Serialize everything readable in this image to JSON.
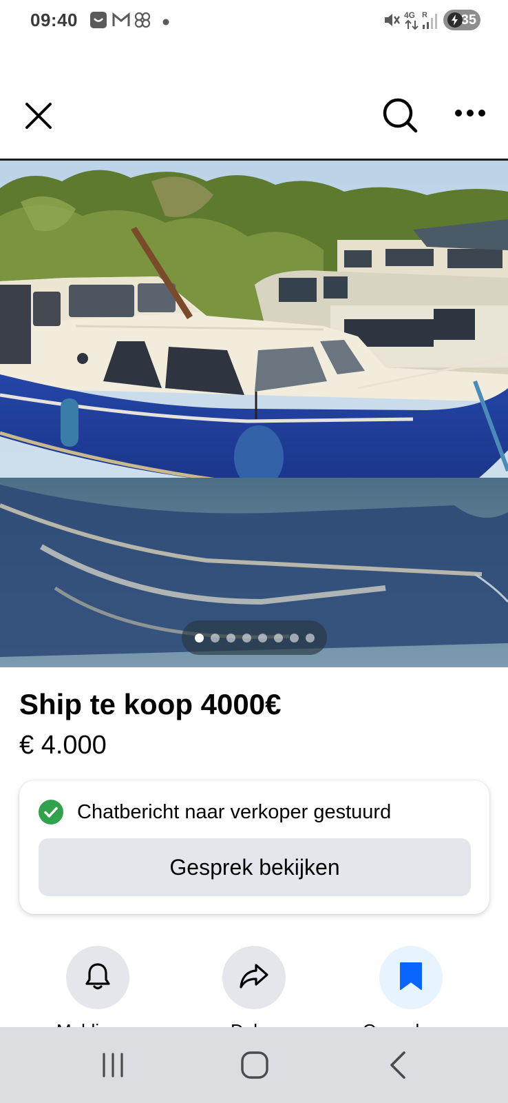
{
  "status_bar": {
    "time": "09:40",
    "battery": "35",
    "icons": [
      "notification-app-icon",
      "gmail-icon",
      "pinwheel-icon",
      "dot-icon",
      "mute-icon",
      "4g-signal-icon",
      "signal-bars-icon",
      "battery-charging-icon"
    ]
  },
  "app_bar": {
    "icons": [
      "close-icon",
      "search-icon",
      "more-options-icon"
    ]
  },
  "photo": {
    "alt": "Blue and white motor boat moored at a pier",
    "pager_count": 8,
    "pager_active": 1
  },
  "listing": {
    "title": "Ship te koop 4000€",
    "price": "€ 4.000"
  },
  "message_card": {
    "status": "Chatbericht naar verkoper gestuurd",
    "button": "Gesprek bekijken"
  },
  "actions": [
    {
      "label": "Meldingen",
      "icon": "bell-icon"
    },
    {
      "label": "Delen",
      "icon": "share-icon"
    },
    {
      "label": "Opgeslagen",
      "icon": "bookmark-icon"
    }
  ],
  "nav_bar": {
    "icons": [
      "recent-apps-icon",
      "home-icon",
      "back-icon"
    ]
  },
  "colors": {
    "accent": "#0866ff",
    "success": "#31a24c",
    "button_bg": "#e4e6eb",
    "boat_hull": "#1f3f9e"
  }
}
